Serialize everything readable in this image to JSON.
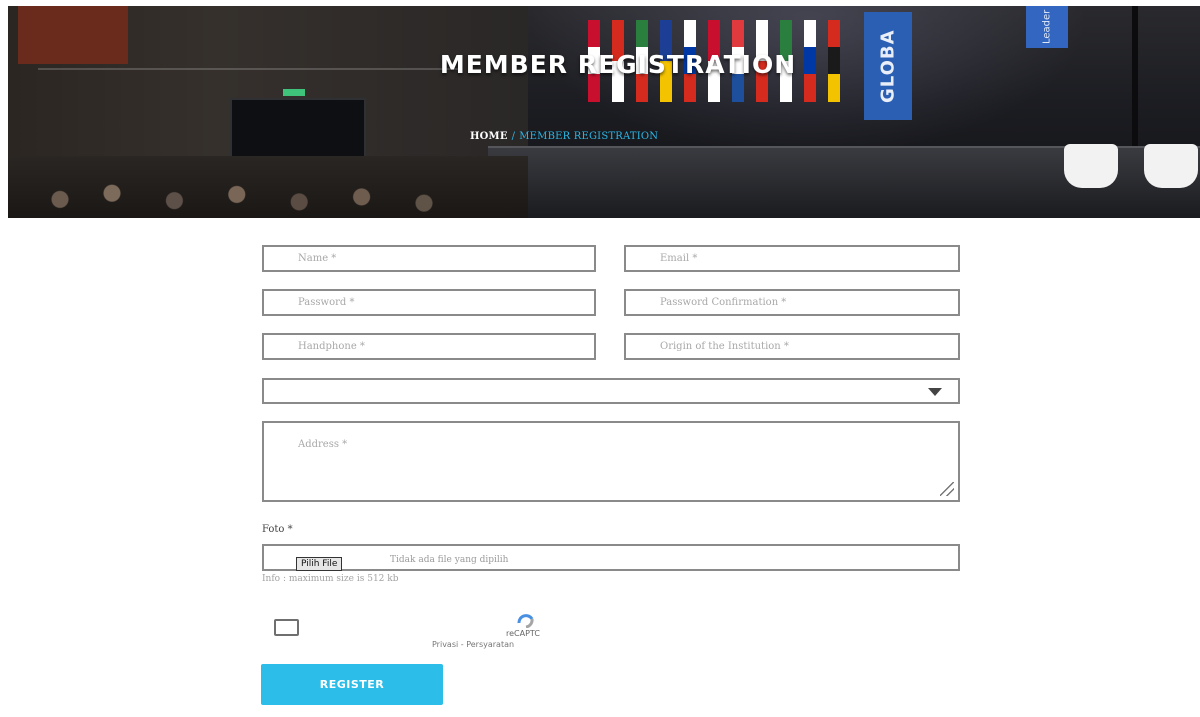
{
  "hero": {
    "title": "MEMBER REGISTRATION",
    "banner_text": "GLOBA",
    "banner2_text": "Leader"
  },
  "breadcrumb": {
    "home": "HOME",
    "separator": "/",
    "current": "MEMBER REGISTRATION"
  },
  "form": {
    "name_placeholder": "Name *",
    "email_placeholder": "Email *",
    "password_placeholder": "Password *",
    "password_confirmation_placeholder": "Password Confirmation *",
    "handphone_placeholder": "Handphone *",
    "institution_placeholder": "Origin of the Institution *",
    "select_value": "",
    "address_placeholder": "Address *",
    "foto_label": "Foto *",
    "choose_file_label": "Pilih File",
    "no_file_text": "Tidak ada file yang dipilih",
    "info_text": "Info : maximum size is 512 kb",
    "recaptcha_label": "reCAPTC",
    "recaptcha_links": "Privasi - Persyaratan",
    "register_label": "REGISTER"
  },
  "colors": {
    "accent": "#2cbde8",
    "breadcrumb_current": "#2bb7e6",
    "field_border": "#8a8a8a"
  },
  "icons": {
    "select": "chevron-down-icon",
    "textarea": "resize-grip-icon",
    "captcha": "recaptcha-icon"
  }
}
